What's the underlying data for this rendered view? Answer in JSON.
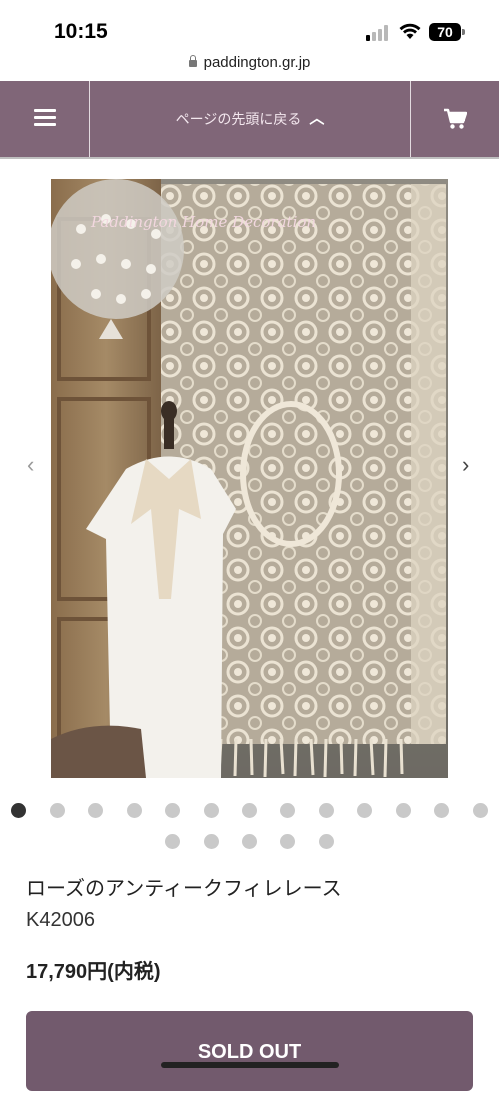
{
  "status_bar": {
    "time": "10:15",
    "battery": "70"
  },
  "browser": {
    "url": "paddington.gr.jp"
  },
  "nav": {
    "back_to_top_label": "ページの先頭に戻る",
    "chevron": "︿"
  },
  "product_image": {
    "watermark": "Paddington Home Decoration"
  },
  "carousel": {
    "prev": "‹",
    "next": "›",
    "dot_count": 18,
    "active_index": 0
  },
  "product": {
    "title": "ローズのアンティークフィレレース",
    "sku": "K42006",
    "price": "17,790円(内税)",
    "sold_out_label": "SOLD OUT"
  },
  "colors": {
    "nav_bg": "#806678",
    "button_bg": "#725a6d"
  }
}
